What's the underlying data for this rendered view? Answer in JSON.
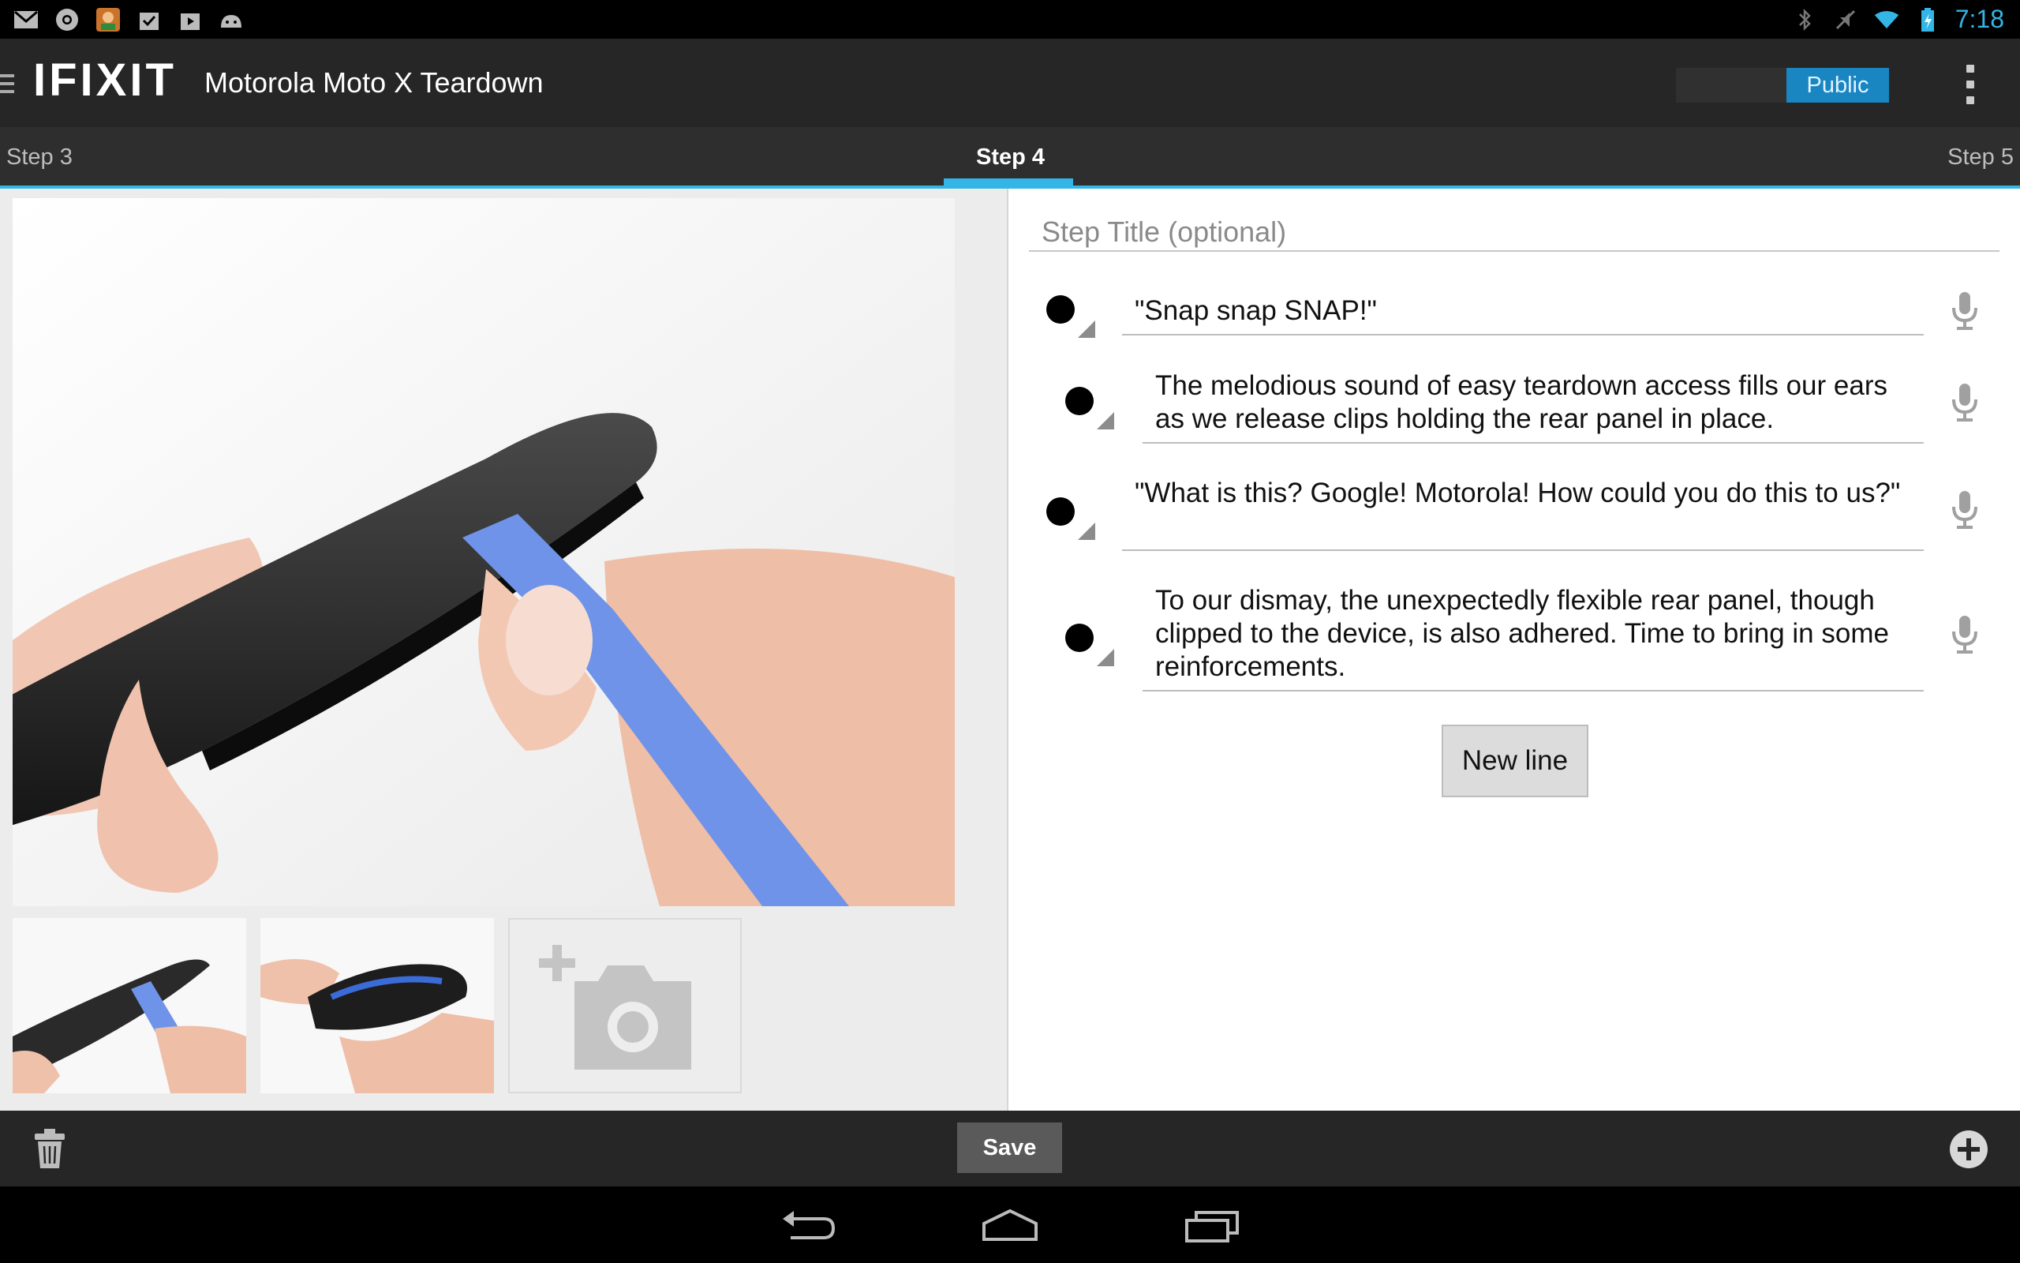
{
  "status_bar": {
    "notification_icons": [
      "gmail-icon",
      "chrome-icon",
      "game-icon",
      "checkmark-bag-icon",
      "play-store-icon",
      "android-icon"
    ],
    "system_icons": [
      "bluetooth-icon",
      "mute-icon",
      "wifi-icon",
      "battery-icon"
    ],
    "time": "7:18"
  },
  "action_bar": {
    "logo": "IFIXIT",
    "title": "Motorola Moto X Teardown",
    "visibility_toggle": "Public"
  },
  "tabs": {
    "prev": "Step 3",
    "current": "Step 4",
    "next": "Step 5"
  },
  "editor": {
    "title_placeholder": "Step Title (optional)",
    "lines": [
      {
        "text": "\"Snap snap SNAP!\""
      },
      {
        "text": "The melodious sound of easy teardown access fills our ears as we release clips holding the rear panel in place."
      },
      {
        "text": "\"What is this? Google! Motorola! How could you do this to us?\""
      },
      {
        "text": "To our dismay, the unexpectedly flexible rear panel, though clipped to the device, is also adhered. Time to bring in some reinforcements."
      }
    ],
    "new_line_button": "New line"
  },
  "bottom_bar": {
    "save": "Save"
  },
  "colors": {
    "accent": "#33b5e5",
    "toggle_on": "#1a86c1",
    "bar_bg": "#262626",
    "tool_blue": "#6f93e8"
  }
}
